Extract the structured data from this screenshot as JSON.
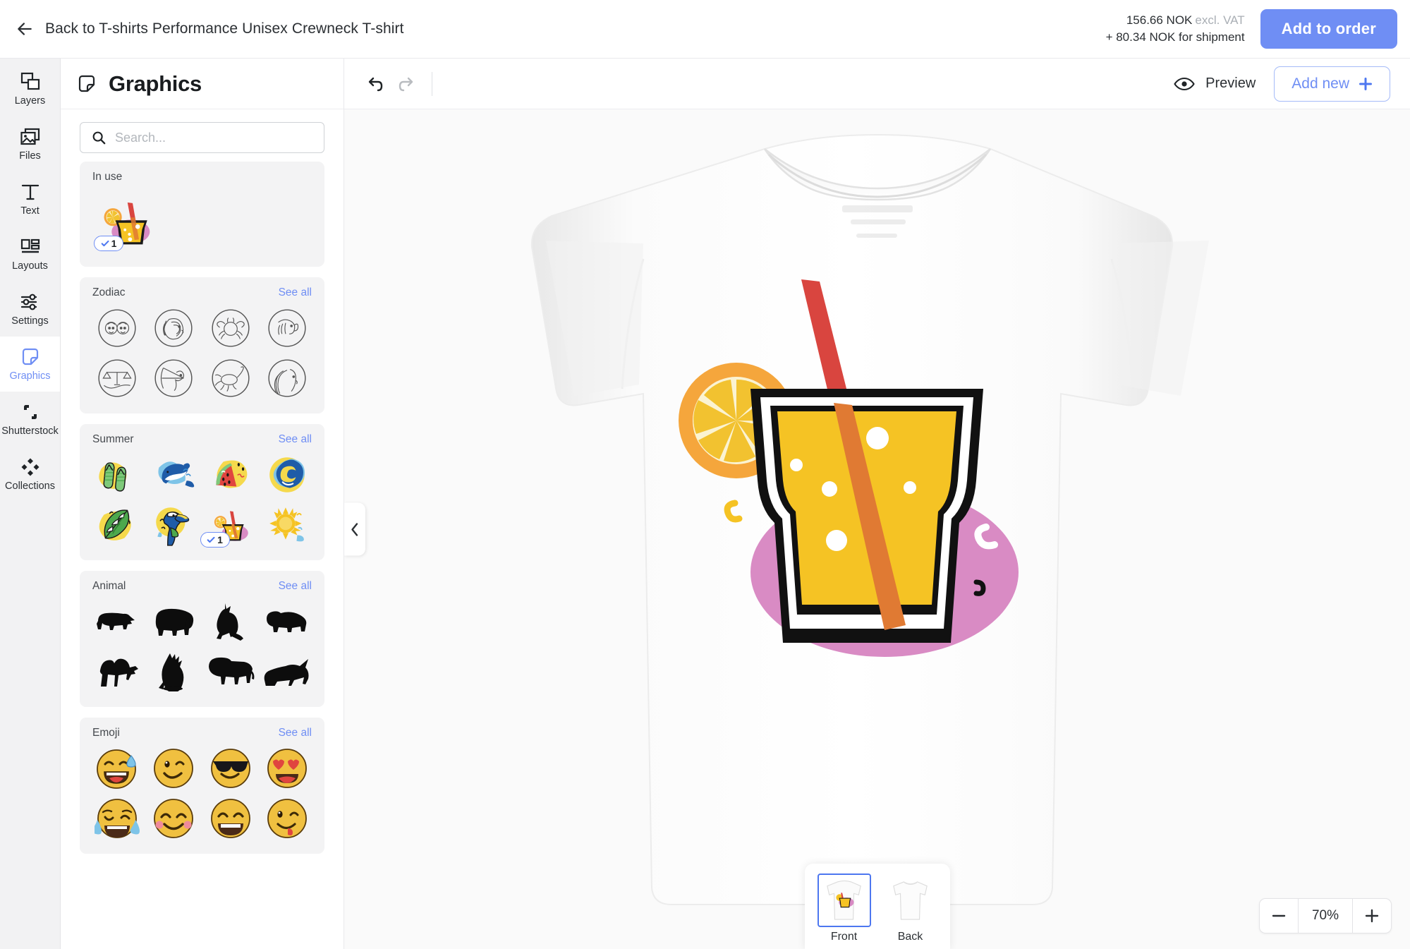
{
  "topbar": {
    "back_label": "Back to T-shirts Performance Unisex Crewneck T-shirt",
    "back_icon": "arrow-left-icon",
    "price_amount": "156.66 NOK",
    "price_vat_note": "excl. VAT",
    "shipment_note": "+ 80.34 NOK for shipment",
    "add_to_order_label": "Add to order",
    "accent_color": "#6f8ef4"
  },
  "rail": {
    "items": [
      {
        "label": "Layers",
        "icon": "layers-icon",
        "active": false
      },
      {
        "label": "Files",
        "icon": "image-icon",
        "active": false
      },
      {
        "label": "Text",
        "icon": "text-icon",
        "active": false
      },
      {
        "label": "Layouts",
        "icon": "layouts-icon",
        "active": false
      },
      {
        "label": "Settings",
        "icon": "sliders-icon",
        "active": false
      },
      {
        "label": "Graphics",
        "icon": "sticker-icon",
        "active": true
      },
      {
        "label": "Shutterstock",
        "icon": "shutterstock-icon",
        "active": false
      },
      {
        "label": "Collections",
        "icon": "collections-icon",
        "active": false
      }
    ]
  },
  "panel": {
    "title": "Graphics",
    "title_icon": "sticker-icon",
    "search_placeholder": "Search...",
    "search_value": "",
    "search_icon": "search-icon",
    "see_all_label": "See all",
    "sections": [
      {
        "title": "In use",
        "has_see_all": false,
        "items": [
          {
            "name": "drink-graphic",
            "badge": "1"
          }
        ]
      },
      {
        "title": "Zodiac",
        "has_see_all": true,
        "items": [
          {
            "name": "zodiac-gemini"
          },
          {
            "name": "zodiac-leo"
          },
          {
            "name": "zodiac-cancer"
          },
          {
            "name": "zodiac-capricorn"
          },
          {
            "name": "zodiac-libra"
          },
          {
            "name": "zodiac-sagittarius"
          },
          {
            "name": "zodiac-scorpio"
          },
          {
            "name": "zodiac-virgo"
          }
        ]
      },
      {
        "title": "Summer",
        "has_see_all": true,
        "items": [
          {
            "name": "flip-flops-graphic"
          },
          {
            "name": "dolphin-graphic"
          },
          {
            "name": "watermelon-graphic"
          },
          {
            "name": "wave-graphic"
          },
          {
            "name": "monstera-leaf-graphic"
          },
          {
            "name": "toucan-graphic"
          },
          {
            "name": "drink-graphic",
            "badge": "1"
          },
          {
            "name": "sun-graphic"
          }
        ]
      },
      {
        "title": "Animal",
        "has_see_all": true,
        "items": [
          {
            "name": "rhino-silhouette"
          },
          {
            "name": "elephant-silhouette"
          },
          {
            "name": "kangaroo-silhouette"
          },
          {
            "name": "hippo-silhouette"
          },
          {
            "name": "camel-silhouette"
          },
          {
            "name": "eagle-silhouette"
          },
          {
            "name": "lion-silhouette"
          },
          {
            "name": "panther-silhouette"
          }
        ]
      },
      {
        "title": "Emoji",
        "has_see_all": true,
        "items": [
          {
            "name": "emoji-grinning-sweat",
            "glyph": "😅"
          },
          {
            "name": "emoji-wink",
            "glyph": "😉"
          },
          {
            "name": "emoji-sunglasses",
            "glyph": "😎"
          },
          {
            "name": "emoji-heart-eyes",
            "glyph": "😍"
          },
          {
            "name": "emoji-tears-of-joy",
            "glyph": "😂"
          },
          {
            "name": "emoji-blush",
            "glyph": "😊"
          },
          {
            "name": "emoji-grin",
            "glyph": "😁"
          },
          {
            "name": "emoji-yum-wink",
            "glyph": "😜"
          }
        ]
      }
    ]
  },
  "canvas_toolbar": {
    "undo_icon": "undo-icon",
    "redo_icon": "redo-icon",
    "preview_label": "Preview",
    "preview_icon": "eye-icon",
    "add_new_label": "Add new",
    "add_new_icon": "plus-icon"
  },
  "stage": {
    "collapse_icon": "chevron-left-icon",
    "product": "white-crewneck-tshirt",
    "design_name": "drink-graphic"
  },
  "view_switcher": {
    "items": [
      {
        "label": "Front",
        "selected": true,
        "thumb": "tshirt-front-thumb"
      },
      {
        "label": "Back",
        "selected": false,
        "thumb": "tshirt-back-thumb"
      }
    ]
  },
  "zoom_control": {
    "minus_icon": "minus-icon",
    "plus_icon": "plus-icon",
    "value": "70%"
  }
}
